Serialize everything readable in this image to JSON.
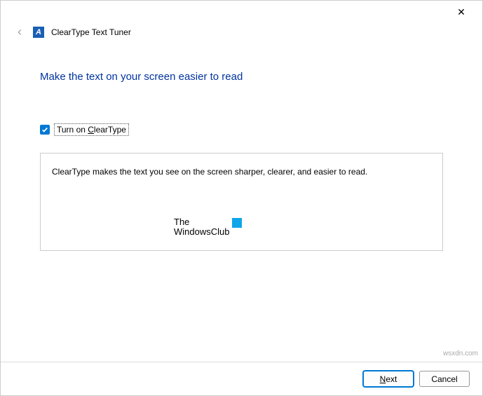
{
  "titlebar": {
    "close_symbol": "✕"
  },
  "header": {
    "back_symbol": "←",
    "app_icon_letter": "A",
    "app_title": "ClearType Text Tuner"
  },
  "main": {
    "heading": "Make the text on your screen easier to read",
    "checkbox_checked": true,
    "checkbox_label_before": "Turn on ",
    "checkbox_label_underlined": "C",
    "checkbox_label_after": "learType",
    "description": "ClearType makes the text you see on the screen sharper, clearer, and easier to read.",
    "watermark_line1": "The",
    "watermark_line2": "WindowsClub"
  },
  "footer": {
    "next_underlined": "N",
    "next_rest": "ext",
    "cancel": "Cancel"
  },
  "credit": "wsxdn.com"
}
